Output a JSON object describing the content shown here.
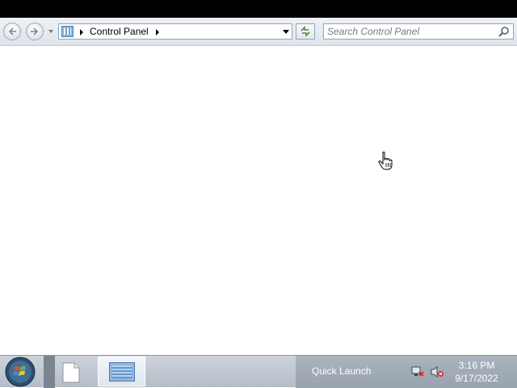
{
  "window": {
    "title": ""
  },
  "navigation": {
    "back_icon": "back-arrow-icon",
    "forward_icon": "forward-arrow-icon",
    "history_icon": "chevron-down-icon"
  },
  "address_bar": {
    "location_icon": "control-panel-icon",
    "breadcrumb": [
      "Control Panel"
    ],
    "dropdown_icon": "chevron-down-icon"
  },
  "refresh": {
    "icon": "refresh-icon"
  },
  "search": {
    "placeholder": "Search Control Panel",
    "value": "",
    "icon": "search-icon"
  },
  "content": {
    "items": []
  },
  "cursor": {
    "icon": "hand-pointer-icon"
  },
  "taskbar": {
    "start_icon": "windows-start-orb-icon",
    "items": [
      {
        "icon": "document-icon",
        "active": false
      },
      {
        "icon": "control-panel-icon",
        "active": true
      }
    ],
    "quick_launch_label": "Quick Launch",
    "tray_icons": [
      "network-disconnected-icon",
      "volume-muted-icon"
    ],
    "clock": {
      "time": "3:16 PM",
      "date": "9/17/2022"
    }
  },
  "colors": {
    "title_bar": "#000000",
    "navbar_bg": "#e5eaf0",
    "taskbar_bg": "#c1c9d2",
    "tray_bg": "#a3adb8",
    "accent_blue": "#4d7eb4"
  }
}
